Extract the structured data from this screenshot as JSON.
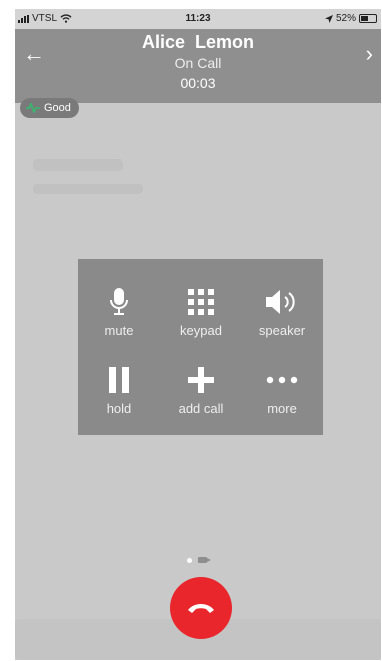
{
  "status_bar": {
    "carrier": "VTSL",
    "time": "11:23",
    "battery": "52%",
    "icons": [
      "signal-icon",
      "wifi-icon",
      "location-arrow-icon",
      "battery-icon"
    ]
  },
  "call": {
    "name": "Alice  Lemon",
    "status": "On Call",
    "timer": "00:03"
  },
  "quality": {
    "label": "Good",
    "color": "#3cb371"
  },
  "controls": [
    {
      "label": "mute",
      "icon": "microphone-icon"
    },
    {
      "label": "keypad",
      "icon": "keypad-icon"
    },
    {
      "label": "speaker",
      "icon": "speaker-icon"
    },
    {
      "label": "hold",
      "icon": "pause-icon"
    },
    {
      "label": "add call",
      "icon": "plus-icon"
    },
    {
      "label": "more",
      "icon": "more-icon"
    }
  ],
  "end_call": {
    "icon": "hang-up-icon",
    "color": "#e8262c"
  }
}
